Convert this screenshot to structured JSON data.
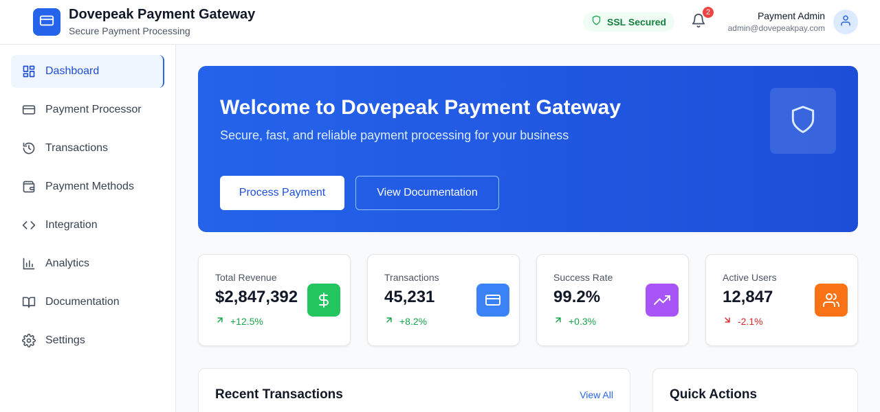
{
  "header": {
    "title": "Dovepeak Payment Gateway",
    "subtitle": "Secure Payment Processing",
    "ssl_badge": "SSL Secured",
    "notification_count": "2",
    "user_name": "Payment Admin",
    "user_email": "admin@dovepeakpay.com",
    "icons": {
      "logo": "credit-card-icon",
      "ssl": "shield-icon",
      "notifications": "bell-icon",
      "avatar": "user-icon"
    }
  },
  "sidebar": {
    "items": [
      {
        "label": "Dashboard",
        "icon": "dashboard-icon",
        "active": true
      },
      {
        "label": "Payment Processor",
        "icon": "credit-card-icon",
        "active": false
      },
      {
        "label": "Transactions",
        "icon": "history-icon",
        "active": false
      },
      {
        "label": "Payment Methods",
        "icon": "wallet-icon",
        "active": false
      },
      {
        "label": "Integration",
        "icon": "code-icon",
        "active": false
      },
      {
        "label": "Analytics",
        "icon": "bar-chart-icon",
        "active": false
      },
      {
        "label": "Documentation",
        "icon": "book-icon",
        "active": false
      },
      {
        "label": "Settings",
        "icon": "gear-icon",
        "active": false
      }
    ]
  },
  "hero": {
    "title": "Welcome to Dovepeak Payment Gateway",
    "subtitle": "Secure, fast, and reliable payment processing for your business",
    "primary_button": "Process Payment",
    "secondary_button": "View Documentation",
    "icon": "shield-icon"
  },
  "stats": [
    {
      "label": "Total Revenue",
      "value": "$2,847,392",
      "change": "+12.5%",
      "trend": "up",
      "icon": "dollar-icon",
      "color": "#22c55e"
    },
    {
      "label": "Transactions",
      "value": "45,231",
      "change": "+8.2%",
      "trend": "up",
      "icon": "credit-card-icon",
      "color": "#3b82f6"
    },
    {
      "label": "Success Rate",
      "value": "99.2%",
      "change": "+0.3%",
      "trend": "up",
      "icon": "trending-up-icon",
      "color": "#a855f7"
    },
    {
      "label": "Active Users",
      "value": "12,847",
      "change": "-2.1%",
      "trend": "down",
      "icon": "users-icon",
      "color": "#f97316"
    }
  ],
  "recent_transactions": {
    "title": "Recent Transactions",
    "link": "View All"
  },
  "quick_actions": {
    "title": "Quick Actions"
  },
  "colors": {
    "accent": "#2563eb",
    "positive": "#16a34a",
    "negative": "#dc2626"
  }
}
